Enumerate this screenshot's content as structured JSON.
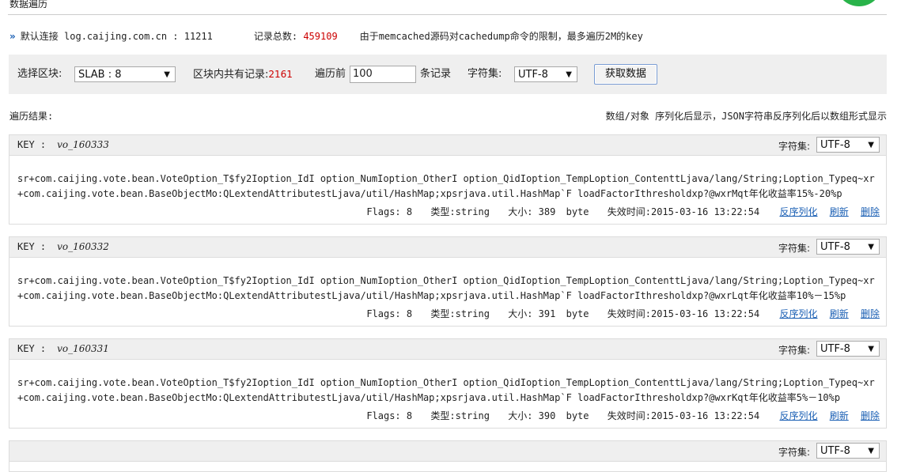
{
  "page": {
    "title": "数据遍历"
  },
  "info": {
    "default_conn_label": "默认连接",
    "default_conn_value": "log.caijing.com.cn : 11211",
    "total_label": "记录总数:",
    "total_value": "459109",
    "note": "由于memcached源码对cachedump命令的限制，最多遍历2M的key"
  },
  "toolbar": {
    "slab_label": "选择区块:",
    "slab_value": "SLAB : 8",
    "block_total_label": "区块内共有记录:",
    "block_total_value": "2161",
    "traverse_prefix": "遍历前",
    "traverse_value": "100",
    "traverse_suffix": "条记录",
    "charset_label": "字符集:",
    "charset_value": "UTF-8",
    "fetch_button": "获取数据"
  },
  "results": {
    "label": "遍历结果:",
    "note": "数组/对象 序列化后显示，JSON字符串反序列化后以数组形式显示"
  },
  "record_labels": {
    "key": "KEY :",
    "charset": "字符集:",
    "flags": "Flags:",
    "type": "类型:",
    "size": "大小:",
    "unit": "byte",
    "expire": "失效时间:",
    "unserialize": "反序列化",
    "refresh": "刷新",
    "delete": "删除"
  },
  "records": [
    {
      "key": "vo_160333",
      "charset": "UTF-8",
      "value": "sr+com.caijing.vote.bean.VoteOption_T$fy2Ioption_IdI option_NumIoption_OtherI option_QidIoption_TempLoption_ContenttLjava/lang/String;Loption_Typeq~xr+com.caijing.vote.bean.BaseObjectMo:QLextendAttributestLjava/util/HashMap;xpsrjava.util.HashMap`F loadFactorIthresholdxp?@wxrMqt年化收益率15%-20%p",
      "flags": "8",
      "type": "string",
      "size": "389",
      "expire": "2015-03-16 13:22:54"
    },
    {
      "key": "vo_160332",
      "charset": "UTF-8",
      "value": "sr+com.caijing.vote.bean.VoteOption_T$fy2Ioption_IdI option_NumIoption_OtherI option_QidIoption_TempLoption_ContenttLjava/lang/String;Loption_Typeq~xr+com.caijing.vote.bean.BaseObjectMo:QLextendAttributestLjava/util/HashMap;xpsrjava.util.HashMap`F loadFactorIthresholdxp?@wxrLqt年化收益率10%－15%p",
      "flags": "8",
      "type": "string",
      "size": "391",
      "expire": "2015-03-16 13:22:54"
    },
    {
      "key": "vo_160331",
      "charset": "UTF-8",
      "value": "sr+com.caijing.vote.bean.VoteOption_T$fy2Ioption_IdI option_NumIoption_OtherI option_QidIoption_TempLoption_ContenttLjava/lang/String;Loption_Typeq~xr+com.caijing.vote.bean.BaseObjectMo:QLextendAttributestLjava/util/HashMap;xpsrjava.util.HashMap`F loadFactorIthresholdxp?@wxrKqt年化收益率5%－10%p",
      "flags": "8",
      "type": "string",
      "size": "390",
      "expire": "2015-03-16 13:22:54"
    }
  ],
  "partial_record": {
    "charset_label": "字符集:",
    "charset_value": "UTF-8"
  }
}
